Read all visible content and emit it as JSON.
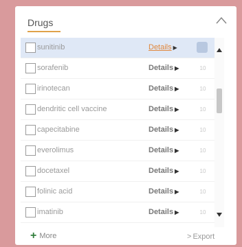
{
  "panel": {
    "title": "Drugs",
    "collapse_icon": "chevron-up-icon"
  },
  "drugs": [
    {
      "name": "sunitinib",
      "details": "Details",
      "count": "18",
      "selected": true
    },
    {
      "name": "sorafenib",
      "details": "Details",
      "count": "10",
      "selected": false
    },
    {
      "name": "irinotecan",
      "details": "Details",
      "count": "10",
      "selected": false
    },
    {
      "name": "dendritic cell vaccine",
      "details": "Details",
      "count": "10",
      "selected": false
    },
    {
      "name": "capecitabine",
      "details": "Details",
      "count": "10",
      "selected": false
    },
    {
      "name": "everolimus",
      "details": "Details",
      "count": "10",
      "selected": false
    },
    {
      "name": "docetaxel",
      "details": "Details",
      "count": "10",
      "selected": false
    },
    {
      "name": "folinic acid",
      "details": "Details",
      "count": "10",
      "selected": false
    },
    {
      "name": "imatinib",
      "details": "Details",
      "count": "10",
      "selected": false
    }
  ],
  "footer": {
    "more_label": "More",
    "export_label": "Export",
    "more_icon": "plus-icon",
    "export_icon": "chevron-right-icon"
  },
  "colors": {
    "background": "#d99a9c",
    "accent": "#e0a24a",
    "selected_row": "#dfe8f6",
    "more_icon": "#2f7d3a"
  }
}
